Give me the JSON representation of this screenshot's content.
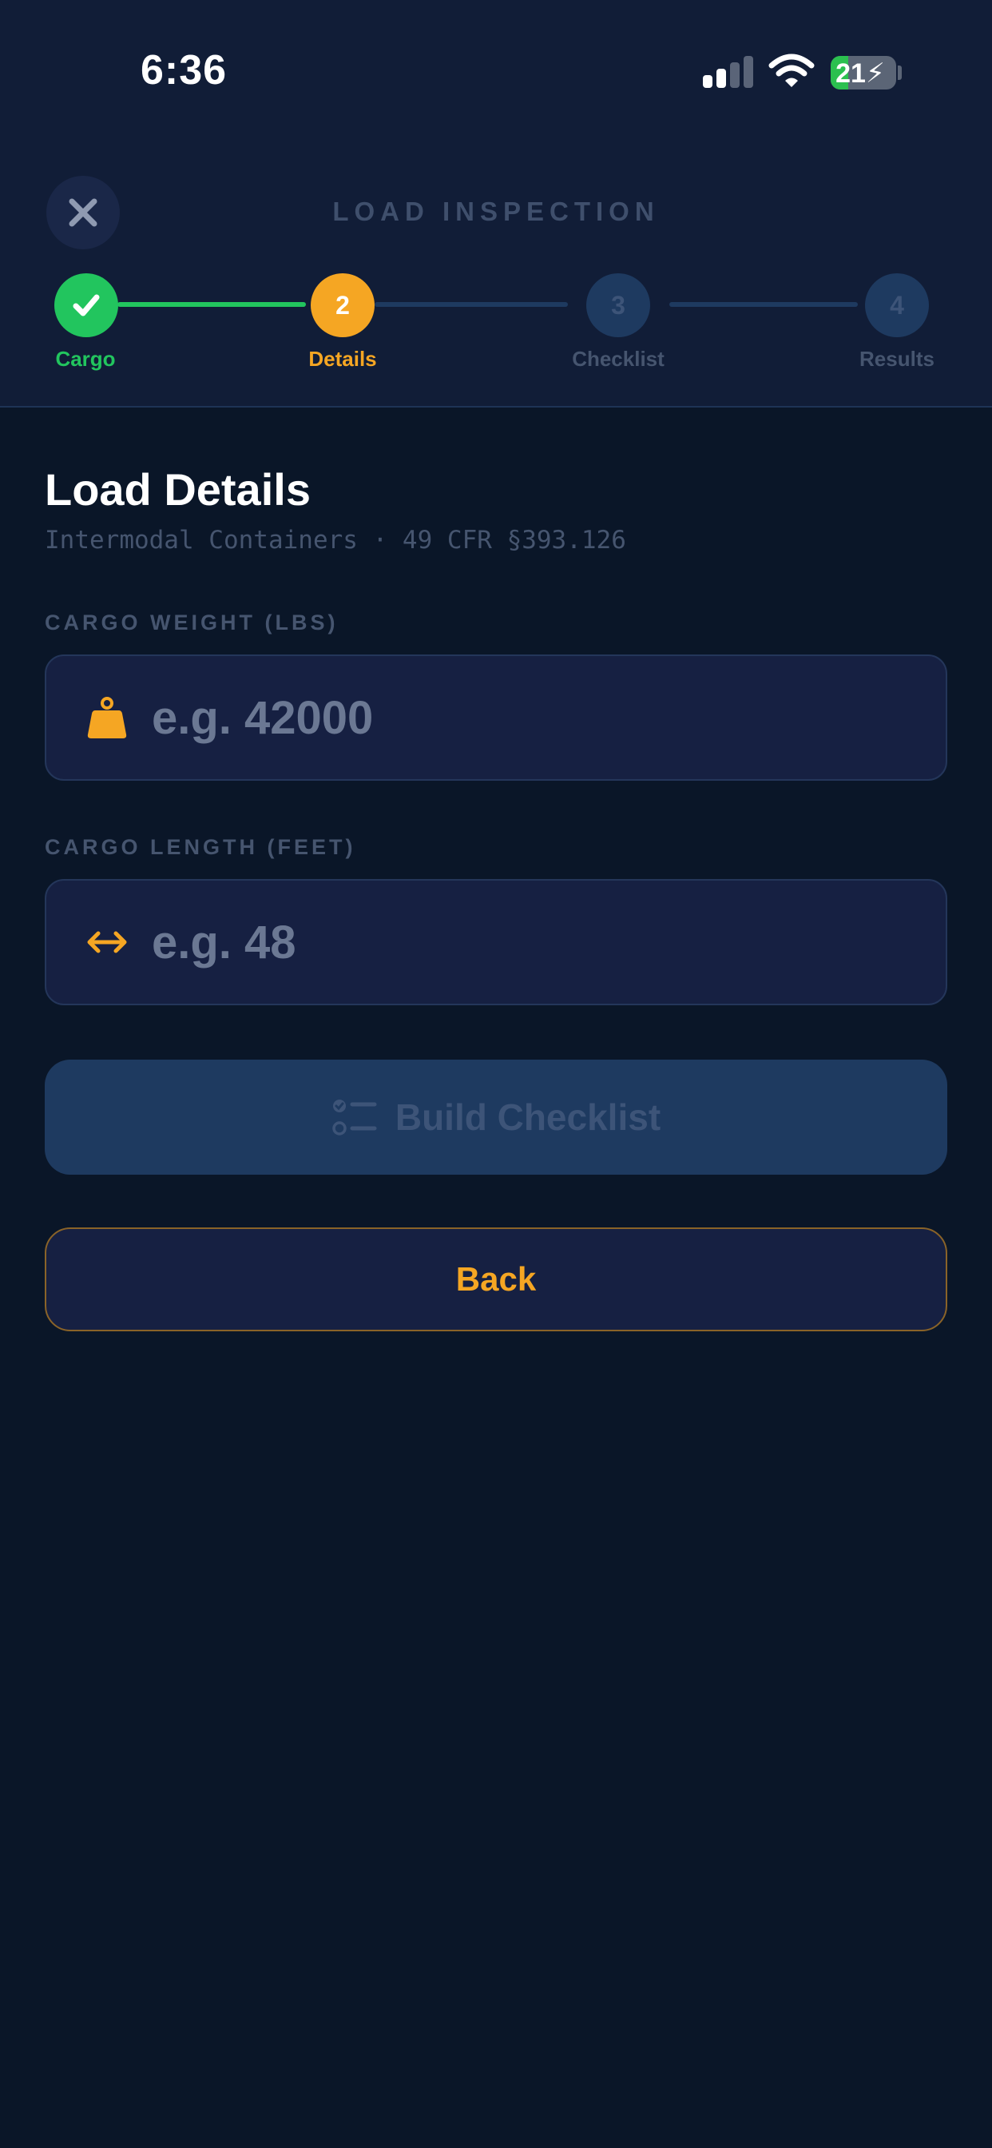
{
  "status_bar": {
    "time": "6:36",
    "battery_percent": "21",
    "icons": [
      "signal-icon",
      "wifi-icon",
      "battery-charging-icon"
    ]
  },
  "header": {
    "title": "LOAD INSPECTION",
    "close_icon": "close-icon"
  },
  "stepper": {
    "steps": [
      {
        "number": "",
        "label": "Cargo",
        "state": "completed"
      },
      {
        "number": "2",
        "label": "Details",
        "state": "active"
      },
      {
        "number": "3",
        "label": "Checklist",
        "state": "upcoming"
      },
      {
        "number": "4",
        "label": "Results",
        "state": "upcoming"
      }
    ]
  },
  "details": {
    "title": "Load Details",
    "subtitle": "Intermodal Containers · 49 CFR §393.126"
  },
  "weight_field": {
    "label": "CARGO WEIGHT (LBS)",
    "placeholder": "e.g. 42000",
    "value": "",
    "icon": "weight-icon"
  },
  "length_field": {
    "label": "CARGO LENGTH (FEET)",
    "placeholder": "e.g. 48",
    "value": "",
    "icon": "horizontal-arrows-icon"
  },
  "actions": {
    "build_label": "Build Checklist",
    "build_icon": "checklist-icon",
    "back_label": "Back"
  },
  "colors": {
    "background": "#0a1628",
    "header_bg": "#111d37",
    "accent": "#f5a623",
    "success": "#22c55e",
    "upcoming_step": "#1e3a60",
    "field_bg": "#162042"
  }
}
